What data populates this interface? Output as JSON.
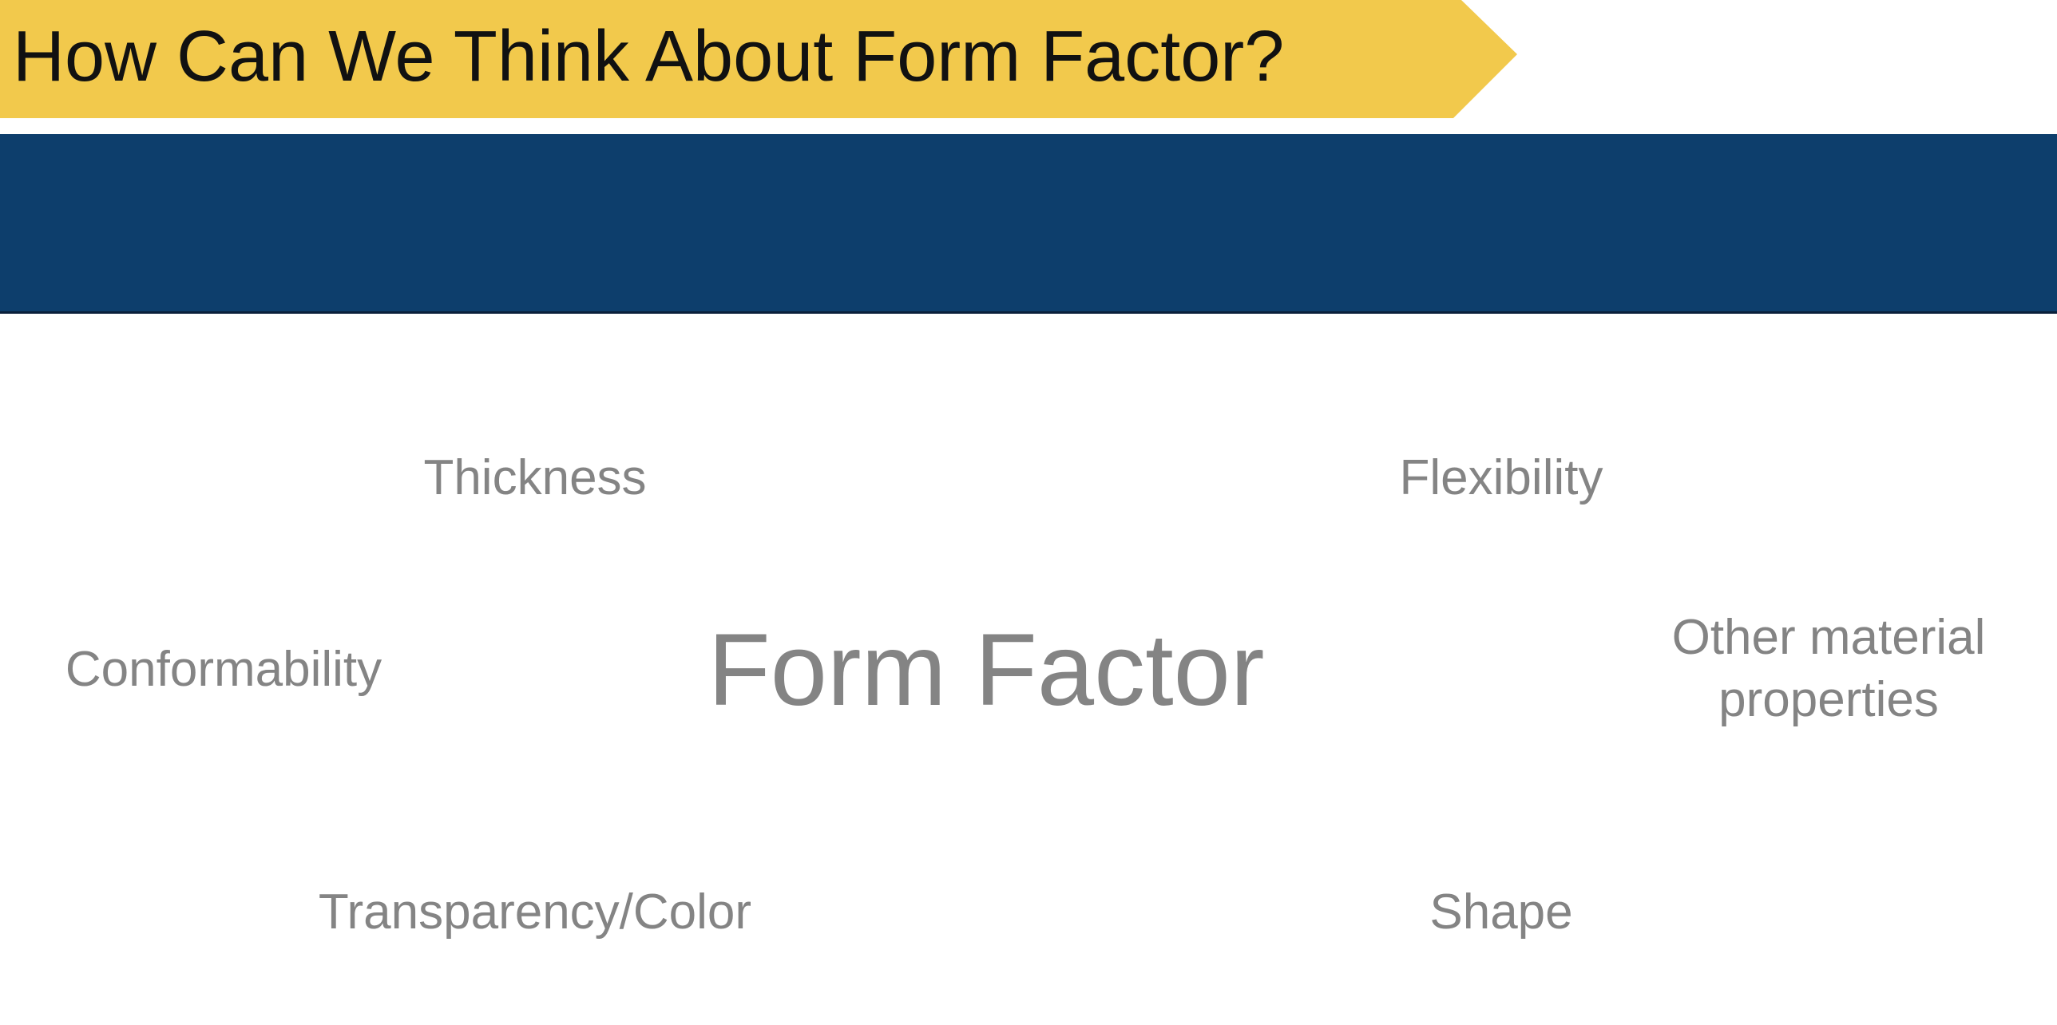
{
  "slide": {
    "title": "How Can We Think About Form Factor?",
    "center_term": "Form Factor",
    "terms": {
      "thickness": "Thickness",
      "flexibility": "Flexibility",
      "conformability": "Conformability",
      "other_material_properties": "Other material properties",
      "transparency_color": "Transparency/Color",
      "shape": "Shape"
    }
  },
  "colors": {
    "title_banner": "#f2c94c",
    "navy_band": "#0d3e6c",
    "term_text": "#848484",
    "title_text": "#111111"
  }
}
